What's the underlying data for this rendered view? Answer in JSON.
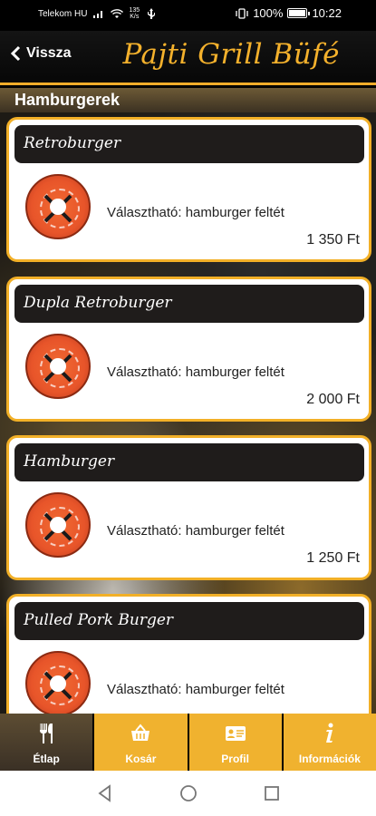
{
  "status_bar": {
    "carrier": "Telekom HU",
    "speed_value": "135",
    "speed_unit": "K/s",
    "battery": "100%",
    "time": "10:22"
  },
  "header": {
    "back_label": "Vissza",
    "title": "Pajti Grill Büfé"
  },
  "section_title": "Hamburgerek",
  "items": [
    {
      "name": "Retroburger",
      "description": "Választható: hamburger feltét",
      "price": "1 350 Ft"
    },
    {
      "name": "Dupla Retroburger",
      "description": "Választható: hamburger feltét",
      "price": "2 000 Ft"
    },
    {
      "name": "Hamburger",
      "description": "Választható: hamburger feltét",
      "price": "1 250 Ft"
    },
    {
      "name": "Pulled Pork Burger",
      "description": "Választható: hamburger feltét",
      "price": ""
    }
  ],
  "tabs": [
    {
      "label": "Étlap",
      "icon": "fork-knife-icon"
    },
    {
      "label": "Kosár",
      "icon": "basket-icon"
    },
    {
      "label": "Profil",
      "icon": "id-card-icon"
    },
    {
      "label": "Információk",
      "icon": "info-icon"
    }
  ],
  "colors": {
    "accent": "#f0b22f",
    "card_header": "#1f1c1b"
  }
}
